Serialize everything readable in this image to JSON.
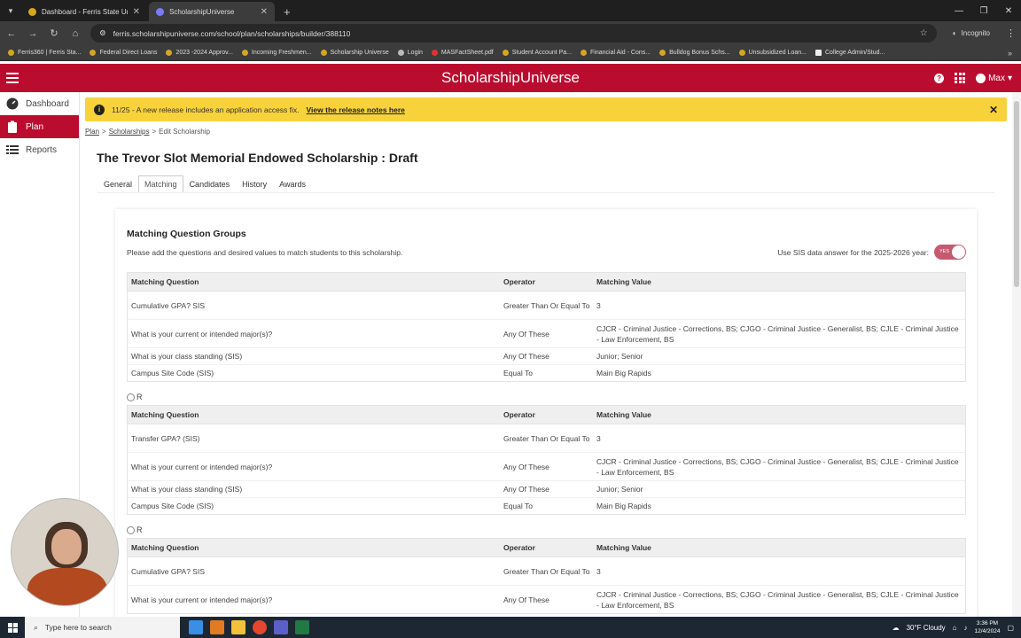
{
  "browser": {
    "tabs": [
      {
        "title": "Dashboard - Ferris State Unive",
        "active": false
      },
      {
        "title": "ScholarshipUniverse",
        "active": true
      }
    ],
    "url": "ferris.scholarshipuniverse.com/school/plan/scholarships/builder/388110",
    "incognito_label": "Incognito",
    "bookmarks": [
      "Ferris360 | Ferris Sta...",
      "Federal Direct Loans",
      "2023 -2024 Approv...",
      "Incoming Freshmen...",
      "Scholarship Universe",
      "Login",
      "MASFactSheet.pdf",
      "Student Account Pa...",
      "Financial Aid - Cons...",
      "Bulldog Bonus Schs...",
      "Unsubsidized Loan...",
      "College Admin/Stud..."
    ]
  },
  "app": {
    "brand": "ScholarshipUniverse",
    "user": "Max",
    "accent_color": "#ba0c2f"
  },
  "sidebar": {
    "items": [
      {
        "label": "Dashboard",
        "icon": "dashboard-icon",
        "active": false
      },
      {
        "label": "Plan",
        "icon": "clipboard-icon",
        "active": true
      },
      {
        "label": "Reports",
        "icon": "reports-icon",
        "active": false
      }
    ]
  },
  "banner": {
    "text": "11/25 - A new release includes an application access fix.",
    "link": "View the release notes here"
  },
  "breadcrumb": {
    "plan": "Plan",
    "scholarships": "Scholarships",
    "current": "Edit Scholarship",
    "sep": ">"
  },
  "page": {
    "title": "The Trevor Slot Memorial Endowed Scholarship : Draft",
    "tabs": [
      "General",
      "Matching",
      "Candidates",
      "History",
      "Awards"
    ],
    "active_tab": "Matching"
  },
  "matching": {
    "heading": "Matching Question Groups",
    "description": "Please add the questions and desired values to match students to this scholarship.",
    "sis_label": "Use SIS data answer for the 2025-2026 year:",
    "sis_toggle": "YES",
    "or_label": "OR",
    "columns": {
      "question": "Matching Question",
      "operator": "Operator",
      "value": "Matching Value"
    },
    "groups": [
      {
        "rows": [
          {
            "q": "Cumulative GPA? SIS",
            "op": "Greater Than Or Equal To",
            "val": "3"
          },
          {
            "q": "What is your current or intended major(s)?",
            "op": "Any Of These",
            "val": "CJCR - Criminal Justice - Corrections, BS; CJGO - Criminal Justice - Generalist, BS; CJLE - Criminal Justice - Law Enforcement, BS"
          },
          {
            "q": "What is your class standing (SIS)",
            "op": "Any Of These",
            "val": "Junior; Senior"
          },
          {
            "q": "Campus Site Code (SIS)",
            "op": "Equal To",
            "val": "Main Big Rapids"
          }
        ]
      },
      {
        "rows": [
          {
            "q": "Transfer GPA? (SIS)",
            "op": "Greater Than Or Equal To",
            "val": "3"
          },
          {
            "q": "What is your current or intended major(s)?",
            "op": "Any Of These",
            "val": "CJCR - Criminal Justice - Corrections, BS; CJGO - Criminal Justice - Generalist, BS; CJLE - Criminal Justice - Law Enforcement, BS"
          },
          {
            "q": "What is your class standing (SIS)",
            "op": "Any Of These",
            "val": "Junior; Senior"
          },
          {
            "q": "Campus Site Code (SIS)",
            "op": "Equal To",
            "val": "Main Big Rapids"
          }
        ]
      },
      {
        "rows": [
          {
            "q": "Cumulative GPA? SIS",
            "op": "Greater Than Or Equal To",
            "val": "3"
          },
          {
            "q": "What is your current or intended major(s)?",
            "op": "Any Of These",
            "val": "CJCR - Criminal Justice - Corrections, BS; CJGO - Criminal Justice - Generalist, BS; CJLE - Criminal Justice - Law Enforcement, BS"
          }
        ]
      }
    ]
  },
  "taskbar": {
    "search_placeholder": "Type here to search",
    "weather": "30°F  Cloudy",
    "time": "3:36 PM",
    "date": "12/4/2024"
  }
}
